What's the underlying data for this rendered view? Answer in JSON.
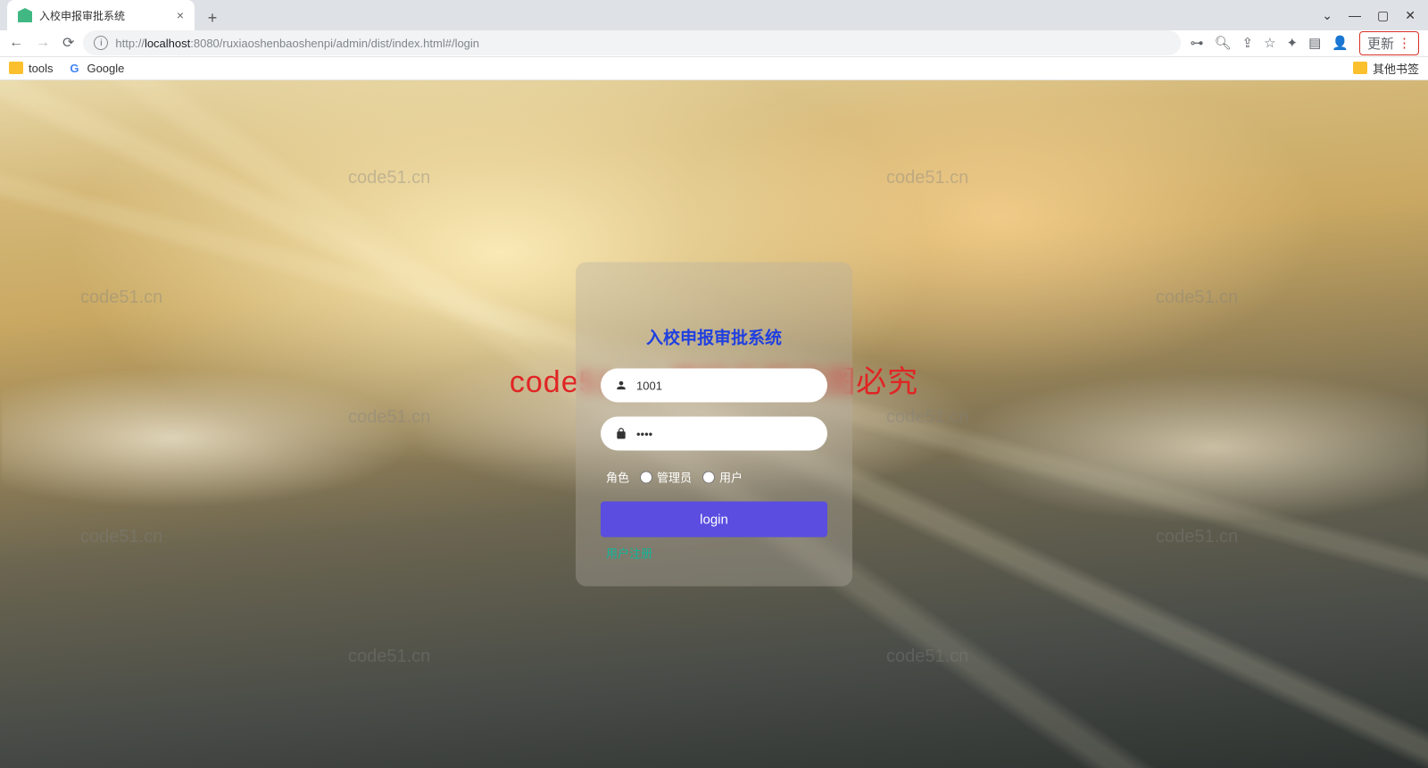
{
  "browser": {
    "tab_title": "入校申报审批系统",
    "url_host": "localhost",
    "url_port": ":8080",
    "url_path": "/ruxiaoshenbaoshenpi/admin/dist/index.html#/login",
    "url_prefix": "http://",
    "update_label": "更新",
    "bookmarks": {
      "tools": "tools",
      "google": "Google",
      "other": "其他书签"
    }
  },
  "watermark_text": "code51.cn",
  "watermark_red": "code51.cn-源码乐园盗图必究",
  "login": {
    "title": "入校申报审批系统",
    "username_value": "1001",
    "password_value": "••••",
    "role_label": "角色",
    "role_admin": "管理员",
    "role_user": "用户",
    "login_button": "login",
    "register_link": "用户注册"
  }
}
